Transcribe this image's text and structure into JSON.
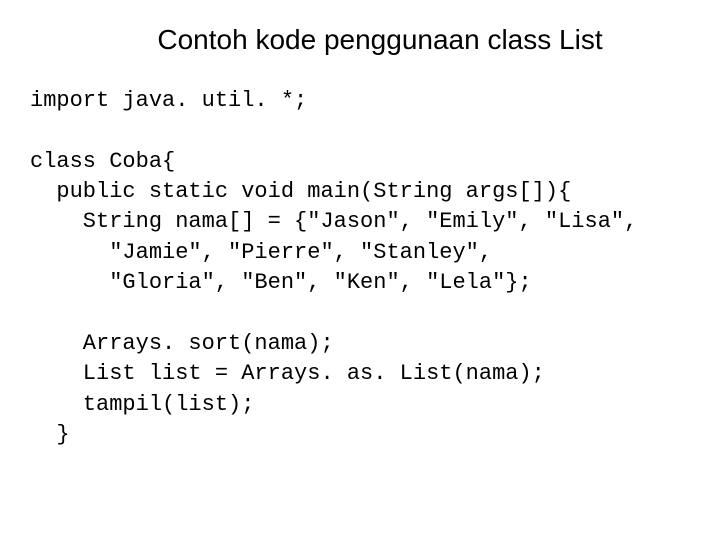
{
  "slide": {
    "title": "Contoh kode penggunaan class List",
    "code": "import java. util. *;\n\nclass Coba{\n  public static void main(String args[]){\n    String nama[] = {\"Jason\", \"Emily\", \"Lisa\",\n      \"Jamie\", \"Pierre\", \"Stanley\",\n      \"Gloria\", \"Ben\", \"Ken\", \"Lela\"};\n\n    Arrays. sort(nama);\n    List list = Arrays. as. List(nama);\n    tampil(list);\n  }"
  }
}
